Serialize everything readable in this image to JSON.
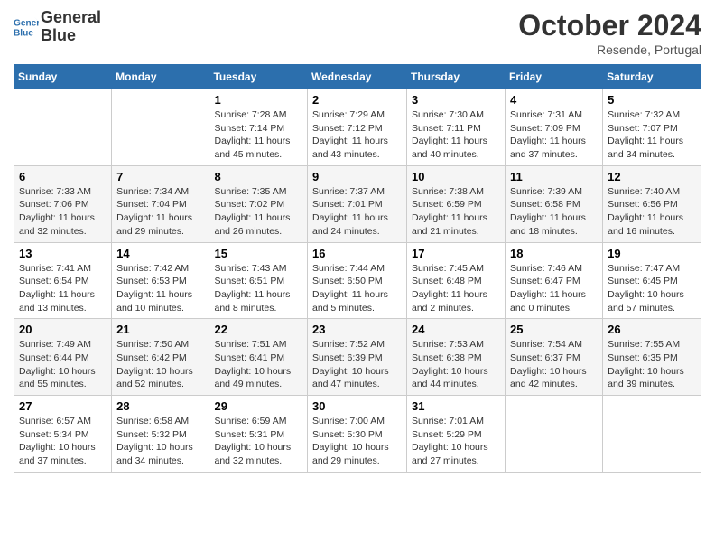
{
  "header": {
    "logo_line1": "General",
    "logo_line2": "Blue",
    "month_title": "October 2024",
    "location": "Resende, Portugal"
  },
  "weekdays": [
    "Sunday",
    "Monday",
    "Tuesday",
    "Wednesday",
    "Thursday",
    "Friday",
    "Saturday"
  ],
  "weeks": [
    [
      {
        "day": "",
        "sunrise": "",
        "sunset": "",
        "daylight": ""
      },
      {
        "day": "",
        "sunrise": "",
        "sunset": "",
        "daylight": ""
      },
      {
        "day": "1",
        "sunrise": "Sunrise: 7:28 AM",
        "sunset": "Sunset: 7:14 PM",
        "daylight": "Daylight: 11 hours and 45 minutes."
      },
      {
        "day": "2",
        "sunrise": "Sunrise: 7:29 AM",
        "sunset": "Sunset: 7:12 PM",
        "daylight": "Daylight: 11 hours and 43 minutes."
      },
      {
        "day": "3",
        "sunrise": "Sunrise: 7:30 AM",
        "sunset": "Sunset: 7:11 PM",
        "daylight": "Daylight: 11 hours and 40 minutes."
      },
      {
        "day": "4",
        "sunrise": "Sunrise: 7:31 AM",
        "sunset": "Sunset: 7:09 PM",
        "daylight": "Daylight: 11 hours and 37 minutes."
      },
      {
        "day": "5",
        "sunrise": "Sunrise: 7:32 AM",
        "sunset": "Sunset: 7:07 PM",
        "daylight": "Daylight: 11 hours and 34 minutes."
      }
    ],
    [
      {
        "day": "6",
        "sunrise": "Sunrise: 7:33 AM",
        "sunset": "Sunset: 7:06 PM",
        "daylight": "Daylight: 11 hours and 32 minutes."
      },
      {
        "day": "7",
        "sunrise": "Sunrise: 7:34 AM",
        "sunset": "Sunset: 7:04 PM",
        "daylight": "Daylight: 11 hours and 29 minutes."
      },
      {
        "day": "8",
        "sunrise": "Sunrise: 7:35 AM",
        "sunset": "Sunset: 7:02 PM",
        "daylight": "Daylight: 11 hours and 26 minutes."
      },
      {
        "day": "9",
        "sunrise": "Sunrise: 7:37 AM",
        "sunset": "Sunset: 7:01 PM",
        "daylight": "Daylight: 11 hours and 24 minutes."
      },
      {
        "day": "10",
        "sunrise": "Sunrise: 7:38 AM",
        "sunset": "Sunset: 6:59 PM",
        "daylight": "Daylight: 11 hours and 21 minutes."
      },
      {
        "day": "11",
        "sunrise": "Sunrise: 7:39 AM",
        "sunset": "Sunset: 6:58 PM",
        "daylight": "Daylight: 11 hours and 18 minutes."
      },
      {
        "day": "12",
        "sunrise": "Sunrise: 7:40 AM",
        "sunset": "Sunset: 6:56 PM",
        "daylight": "Daylight: 11 hours and 16 minutes."
      }
    ],
    [
      {
        "day": "13",
        "sunrise": "Sunrise: 7:41 AM",
        "sunset": "Sunset: 6:54 PM",
        "daylight": "Daylight: 11 hours and 13 minutes."
      },
      {
        "day": "14",
        "sunrise": "Sunrise: 7:42 AM",
        "sunset": "Sunset: 6:53 PM",
        "daylight": "Daylight: 11 hours and 10 minutes."
      },
      {
        "day": "15",
        "sunrise": "Sunrise: 7:43 AM",
        "sunset": "Sunset: 6:51 PM",
        "daylight": "Daylight: 11 hours and 8 minutes."
      },
      {
        "day": "16",
        "sunrise": "Sunrise: 7:44 AM",
        "sunset": "Sunset: 6:50 PM",
        "daylight": "Daylight: 11 hours and 5 minutes."
      },
      {
        "day": "17",
        "sunrise": "Sunrise: 7:45 AM",
        "sunset": "Sunset: 6:48 PM",
        "daylight": "Daylight: 11 hours and 2 minutes."
      },
      {
        "day": "18",
        "sunrise": "Sunrise: 7:46 AM",
        "sunset": "Sunset: 6:47 PM",
        "daylight": "Daylight: 11 hours and 0 minutes."
      },
      {
        "day": "19",
        "sunrise": "Sunrise: 7:47 AM",
        "sunset": "Sunset: 6:45 PM",
        "daylight": "Daylight: 10 hours and 57 minutes."
      }
    ],
    [
      {
        "day": "20",
        "sunrise": "Sunrise: 7:49 AM",
        "sunset": "Sunset: 6:44 PM",
        "daylight": "Daylight: 10 hours and 55 minutes."
      },
      {
        "day": "21",
        "sunrise": "Sunrise: 7:50 AM",
        "sunset": "Sunset: 6:42 PM",
        "daylight": "Daylight: 10 hours and 52 minutes."
      },
      {
        "day": "22",
        "sunrise": "Sunrise: 7:51 AM",
        "sunset": "Sunset: 6:41 PM",
        "daylight": "Daylight: 10 hours and 49 minutes."
      },
      {
        "day": "23",
        "sunrise": "Sunrise: 7:52 AM",
        "sunset": "Sunset: 6:39 PM",
        "daylight": "Daylight: 10 hours and 47 minutes."
      },
      {
        "day": "24",
        "sunrise": "Sunrise: 7:53 AM",
        "sunset": "Sunset: 6:38 PM",
        "daylight": "Daylight: 10 hours and 44 minutes."
      },
      {
        "day": "25",
        "sunrise": "Sunrise: 7:54 AM",
        "sunset": "Sunset: 6:37 PM",
        "daylight": "Daylight: 10 hours and 42 minutes."
      },
      {
        "day": "26",
        "sunrise": "Sunrise: 7:55 AM",
        "sunset": "Sunset: 6:35 PM",
        "daylight": "Daylight: 10 hours and 39 minutes."
      }
    ],
    [
      {
        "day": "27",
        "sunrise": "Sunrise: 6:57 AM",
        "sunset": "Sunset: 5:34 PM",
        "daylight": "Daylight: 10 hours and 37 minutes."
      },
      {
        "day": "28",
        "sunrise": "Sunrise: 6:58 AM",
        "sunset": "Sunset: 5:32 PM",
        "daylight": "Daylight: 10 hours and 34 minutes."
      },
      {
        "day": "29",
        "sunrise": "Sunrise: 6:59 AM",
        "sunset": "Sunset: 5:31 PM",
        "daylight": "Daylight: 10 hours and 32 minutes."
      },
      {
        "day": "30",
        "sunrise": "Sunrise: 7:00 AM",
        "sunset": "Sunset: 5:30 PM",
        "daylight": "Daylight: 10 hours and 29 minutes."
      },
      {
        "day": "31",
        "sunrise": "Sunrise: 7:01 AM",
        "sunset": "Sunset: 5:29 PM",
        "daylight": "Daylight: 10 hours and 27 minutes."
      },
      {
        "day": "",
        "sunrise": "",
        "sunset": "",
        "daylight": ""
      },
      {
        "day": "",
        "sunrise": "",
        "sunset": "",
        "daylight": ""
      }
    ]
  ]
}
